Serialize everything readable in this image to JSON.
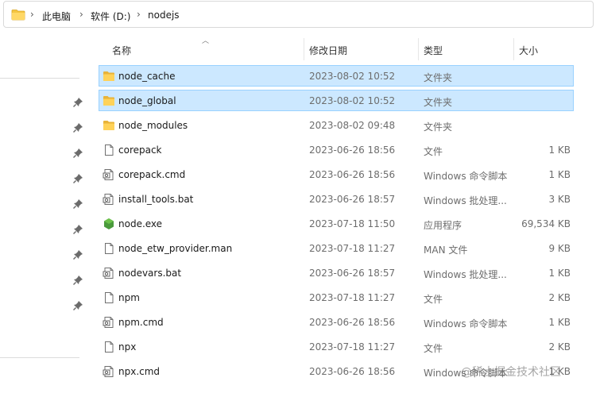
{
  "breadcrumb": [
    "此电脑",
    "软件 (D:)",
    "nodejs"
  ],
  "columns": {
    "name": "名称",
    "date": "修改日期",
    "type": "类型",
    "size": "大小"
  },
  "files": [
    {
      "name": "node_cache",
      "date": "2023-08-02 10:52",
      "type": "文件夹",
      "size": "",
      "icon": "folder-icon",
      "selected": true
    },
    {
      "name": "node_global",
      "date": "2023-08-02 10:52",
      "type": "文件夹",
      "size": "",
      "icon": "folder-icon",
      "selected": true
    },
    {
      "name": "node_modules",
      "date": "2023-08-02 09:48",
      "type": "文件夹",
      "size": "",
      "icon": "folder-icon",
      "selected": false
    },
    {
      "name": "corepack",
      "date": "2023-06-26 18:56",
      "type": "文件",
      "size": "1 KB",
      "icon": "file-icon",
      "selected": false
    },
    {
      "name": "corepack.cmd",
      "date": "2023-06-26 18:56",
      "type": "Windows 命令脚本",
      "size": "1 KB",
      "icon": "script-file-icon",
      "selected": false
    },
    {
      "name": "install_tools.bat",
      "date": "2023-06-26 18:57",
      "type": "Windows 批处理...",
      "size": "3 KB",
      "icon": "script-file-icon",
      "selected": false
    },
    {
      "name": "node.exe",
      "date": "2023-07-18 11:50",
      "type": "应用程序",
      "size": "69,534 KB",
      "icon": "nodejs-icon",
      "selected": false
    },
    {
      "name": "node_etw_provider.man",
      "date": "2023-07-18 11:27",
      "type": "MAN 文件",
      "size": "9 KB",
      "icon": "file-icon",
      "selected": false
    },
    {
      "name": "nodevars.bat",
      "date": "2023-06-26 18:57",
      "type": "Windows 批处理...",
      "size": "1 KB",
      "icon": "script-file-icon",
      "selected": false
    },
    {
      "name": "npm",
      "date": "2023-07-18 11:27",
      "type": "文件",
      "size": "2 KB",
      "icon": "file-icon",
      "selected": false
    },
    {
      "name": "npm.cmd",
      "date": "2023-06-26 18:56",
      "type": "Windows 命令脚本",
      "size": "1 KB",
      "icon": "script-file-icon",
      "selected": false
    },
    {
      "name": "npx",
      "date": "2023-07-18 11:27",
      "type": "文件",
      "size": "2 KB",
      "icon": "file-icon",
      "selected": false
    },
    {
      "name": "npx.cmd",
      "date": "2023-06-26 18:56",
      "type": "Windows 命令脚本",
      "size": "1 KB",
      "icon": "script-file-icon",
      "selected": false
    }
  ],
  "watermark": "@稀土掘金技术社区",
  "colors": {
    "selection_bg": "#cce8ff",
    "selection_border": "#99d1ff",
    "folder": "#f4c542",
    "node_green": "#4a9a3c"
  }
}
